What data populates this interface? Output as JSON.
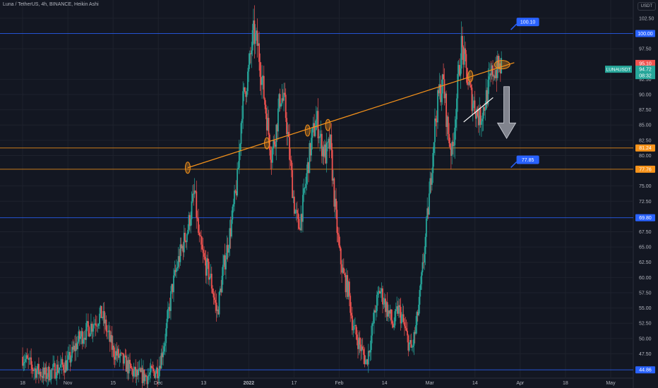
{
  "header": {
    "title": "Luna / TetherUS, 4h, BINANCE, Heikin Ashi",
    "currency": "USDT"
  },
  "colors": {
    "background": "#131722",
    "grid": "#1e222d",
    "up": "#26a69a",
    "down": "#ef5350",
    "blue_line": "#2962ff",
    "orange": "#f7931a",
    "axis_text": "#b2b5be"
  },
  "chart_data": {
    "type": "candlestick",
    "symbol_label": "LUNAUSDT",
    "chart_style": "Heikin Ashi",
    "ylim": [
      43.5,
      105.5
    ],
    "y_ticks": [
      "102.50",
      "97.50",
      "92.50",
      "90.00",
      "87.50",
      "85.00",
      "82.50",
      "80.00",
      "75.00",
      "72.50",
      "67.50",
      "65.00",
      "62.50",
      "60.00",
      "57.50",
      "55.00",
      "52.50",
      "50.00",
      "47.50"
    ],
    "x_ticks": [
      "18",
      "Nov",
      "15",
      "Dec",
      "13",
      "2022",
      "17",
      "Feb",
      "14",
      "Mar",
      "14",
      "Apr",
      "18",
      "May"
    ],
    "x_tick_positions": [
      0.0,
      2.0,
      4.0,
      6.0,
      8.0,
      10.0,
      12.0,
      14.0,
      16.0,
      18.0,
      20.0,
      22.0,
      24.0,
      26.0
    ],
    "x_range": [
      -1.0,
      27.0
    ],
    "horizontal_levels": [
      {
        "value": 100.0,
        "label": "100.00",
        "color": "#2962ff"
      },
      {
        "value": 81.24,
        "label": "81.24",
        "color": "#f7931a"
      },
      {
        "value": 77.76,
        "label": "77.76",
        "color": "#f7931a"
      },
      {
        "value": 69.8,
        "label": "69.80",
        "color": "#2962ff"
      },
      {
        "value": 44.86,
        "label": "44.86",
        "color": "#2962ff"
      }
    ],
    "callouts": [
      {
        "text": "100.10",
        "x": 21.9,
        "y": 101.9
      },
      {
        "text": "77.85",
        "x": 21.9,
        "y": 79.3
      }
    ],
    "price_tags": [
      {
        "text": "95.10",
        "value": 95.1,
        "color": "#ef5350"
      },
      {
        "text": "94.72",
        "value": 94.15,
        "color": "#26a69a"
      },
      {
        "text": "08:32",
        "value": 93.1,
        "color": "#26a69a"
      }
    ],
    "trendline": {
      "x1": 7.3,
      "y1": 78.0,
      "x2": 21.3,
      "y2": 95.0,
      "color": "#f7931a"
    },
    "touch_points": [
      {
        "x": 7.3,
        "y": 78.0
      },
      {
        "x": 10.8,
        "y": 82.0
      },
      {
        "x": 12.6,
        "y": 84.1
      },
      {
        "x": 13.5,
        "y": 85.0
      },
      {
        "x": 19.8,
        "y": 93.0
      },
      {
        "x": 21.2,
        "y": 94.9
      }
    ],
    "white_segment": {
      "x1": 19.5,
      "y1": 85.5,
      "x2": 20.8,
      "y2": 89.5
    },
    "down_arrow": {
      "x": 21.4,
      "ytop": 91.3,
      "ybottom": 82.8
    },
    "price_anchors": [
      [
        0.0,
        47
      ],
      [
        0.5,
        45
      ],
      [
        1.0,
        44
      ],
      [
        1.5,
        45
      ],
      [
        2.0,
        46
      ],
      [
        2.5,
        50
      ],
      [
        3.0,
        52
      ],
      [
        3.5,
        54
      ],
      [
        4.0,
        48
      ],
      [
        4.5,
        46
      ],
      [
        5.0,
        44
      ],
      [
        5.5,
        43.8
      ],
      [
        6.0,
        45
      ],
      [
        6.3,
        50
      ],
      [
        6.6,
        58
      ],
      [
        6.9,
        63
      ],
      [
        7.3,
        68
      ],
      [
        7.6,
        74
      ],
      [
        7.8,
        66
      ],
      [
        8.0,
        63
      ],
      [
        8.3,
        60
      ],
      [
        8.6,
        54
      ],
      [
        8.9,
        62
      ],
      [
        9.2,
        68
      ],
      [
        9.5,
        76
      ],
      [
        9.7,
        88
      ],
      [
        10.0,
        94
      ],
      [
        10.2,
        100
      ],
      [
        10.4,
        98
      ],
      [
        10.6,
        92
      ],
      [
        10.8,
        86
      ],
      [
        11.0,
        80
      ],
      [
        11.2,
        84
      ],
      [
        11.4,
        90
      ],
      [
        11.6,
        88
      ],
      [
        11.8,
        80
      ],
      [
        12.0,
        72
      ],
      [
        12.2,
        68
      ],
      [
        12.4,
        72
      ],
      [
        12.6,
        78
      ],
      [
        12.8,
        83
      ],
      [
        13.0,
        86
      ],
      [
        13.2,
        82
      ],
      [
        13.4,
        80
      ],
      [
        13.6,
        82
      ],
      [
        13.8,
        72
      ],
      [
        14.0,
        64
      ],
      [
        14.2,
        60
      ],
      [
        14.4,
        58
      ],
      [
        14.6,
        52
      ],
      [
        14.8,
        50
      ],
      [
        15.0,
        48
      ],
      [
        15.2,
        46
      ],
      [
        15.4,
        50
      ],
      [
        15.6,
        55
      ],
      [
        15.8,
        58
      ],
      [
        16.0,
        56
      ],
      [
        16.2,
        54
      ],
      [
        16.4,
        52
      ],
      [
        16.6,
        55
      ],
      [
        16.8,
        53
      ],
      [
        17.0,
        50
      ],
      [
        17.2,
        48
      ],
      [
        17.4,
        52
      ],
      [
        17.6,
        58
      ],
      [
        17.8,
        66
      ],
      [
        18.0,
        74
      ],
      [
        18.2,
        84
      ],
      [
        18.4,
        90
      ],
      [
        18.6,
        92
      ],
      [
        18.8,
        84
      ],
      [
        19.0,
        80
      ],
      [
        19.2,
        90
      ],
      [
        19.4,
        98
      ],
      [
        19.6,
        94
      ],
      [
        19.8,
        90
      ],
      [
        20.0,
        88
      ],
      [
        20.2,
        86
      ],
      [
        20.4,
        88
      ],
      [
        20.6,
        91
      ],
      [
        20.8,
        94
      ],
      [
        21.0,
        94.2
      ],
      [
        21.2,
        94.7
      ]
    ]
  }
}
